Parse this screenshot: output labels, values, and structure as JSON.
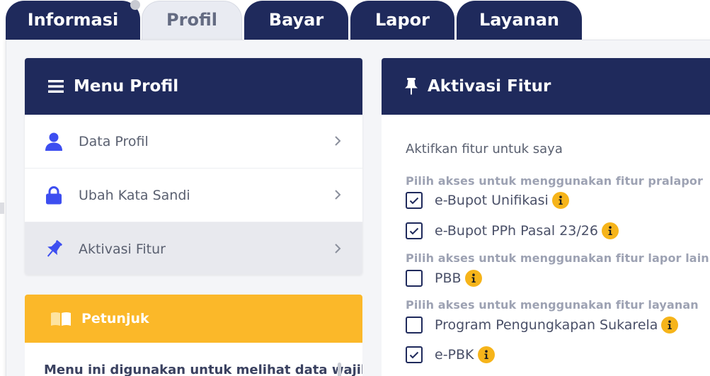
{
  "tabs": [
    {
      "label": "Informasi",
      "active": false
    },
    {
      "label": "Profil",
      "active": true
    },
    {
      "label": "Bayar",
      "active": false
    },
    {
      "label": "Lapor",
      "active": false
    },
    {
      "label": "Layanan",
      "active": false
    }
  ],
  "menu_profil": {
    "title": "Menu Profil",
    "items": [
      {
        "label": "Data Profil",
        "icon": "user-icon",
        "active": false
      },
      {
        "label": "Ubah Kata Sandi",
        "icon": "lock-icon",
        "active": false
      },
      {
        "label": "Aktivasi Fitur",
        "icon": "pin-icon",
        "active": true
      }
    ]
  },
  "petunjuk": {
    "title": "Petunjuk",
    "body": "Menu ini digunakan untuk melihat data wajib"
  },
  "aktivasi": {
    "title": "Aktivasi Fitur",
    "intro": "Aktifkan fitur untuk saya",
    "groups": [
      {
        "label": "Pilih akses untuk menggunakan fitur pralapor",
        "options": [
          {
            "label": "e-Bupot Unifikasi",
            "checked": true
          },
          {
            "label": "e-Bupot PPh Pasal 23/26",
            "checked": true
          }
        ]
      },
      {
        "label": "Pilih akses untuk menggunakan fitur lapor lainnya",
        "options": [
          {
            "label": "PBB",
            "checked": false
          }
        ]
      },
      {
        "label": "Pilih akses untuk menggunakan fitur layanan",
        "options": [
          {
            "label": "Program Pengungkapan Sukarela",
            "checked": false
          },
          {
            "label": "e-PBK",
            "checked": true
          }
        ]
      }
    ]
  },
  "colors": {
    "navy": "#1f2a5c",
    "accent_blue": "#3d4ef0",
    "warning_yellow": "#fbb829",
    "info_yellow": "#f6b41a"
  }
}
